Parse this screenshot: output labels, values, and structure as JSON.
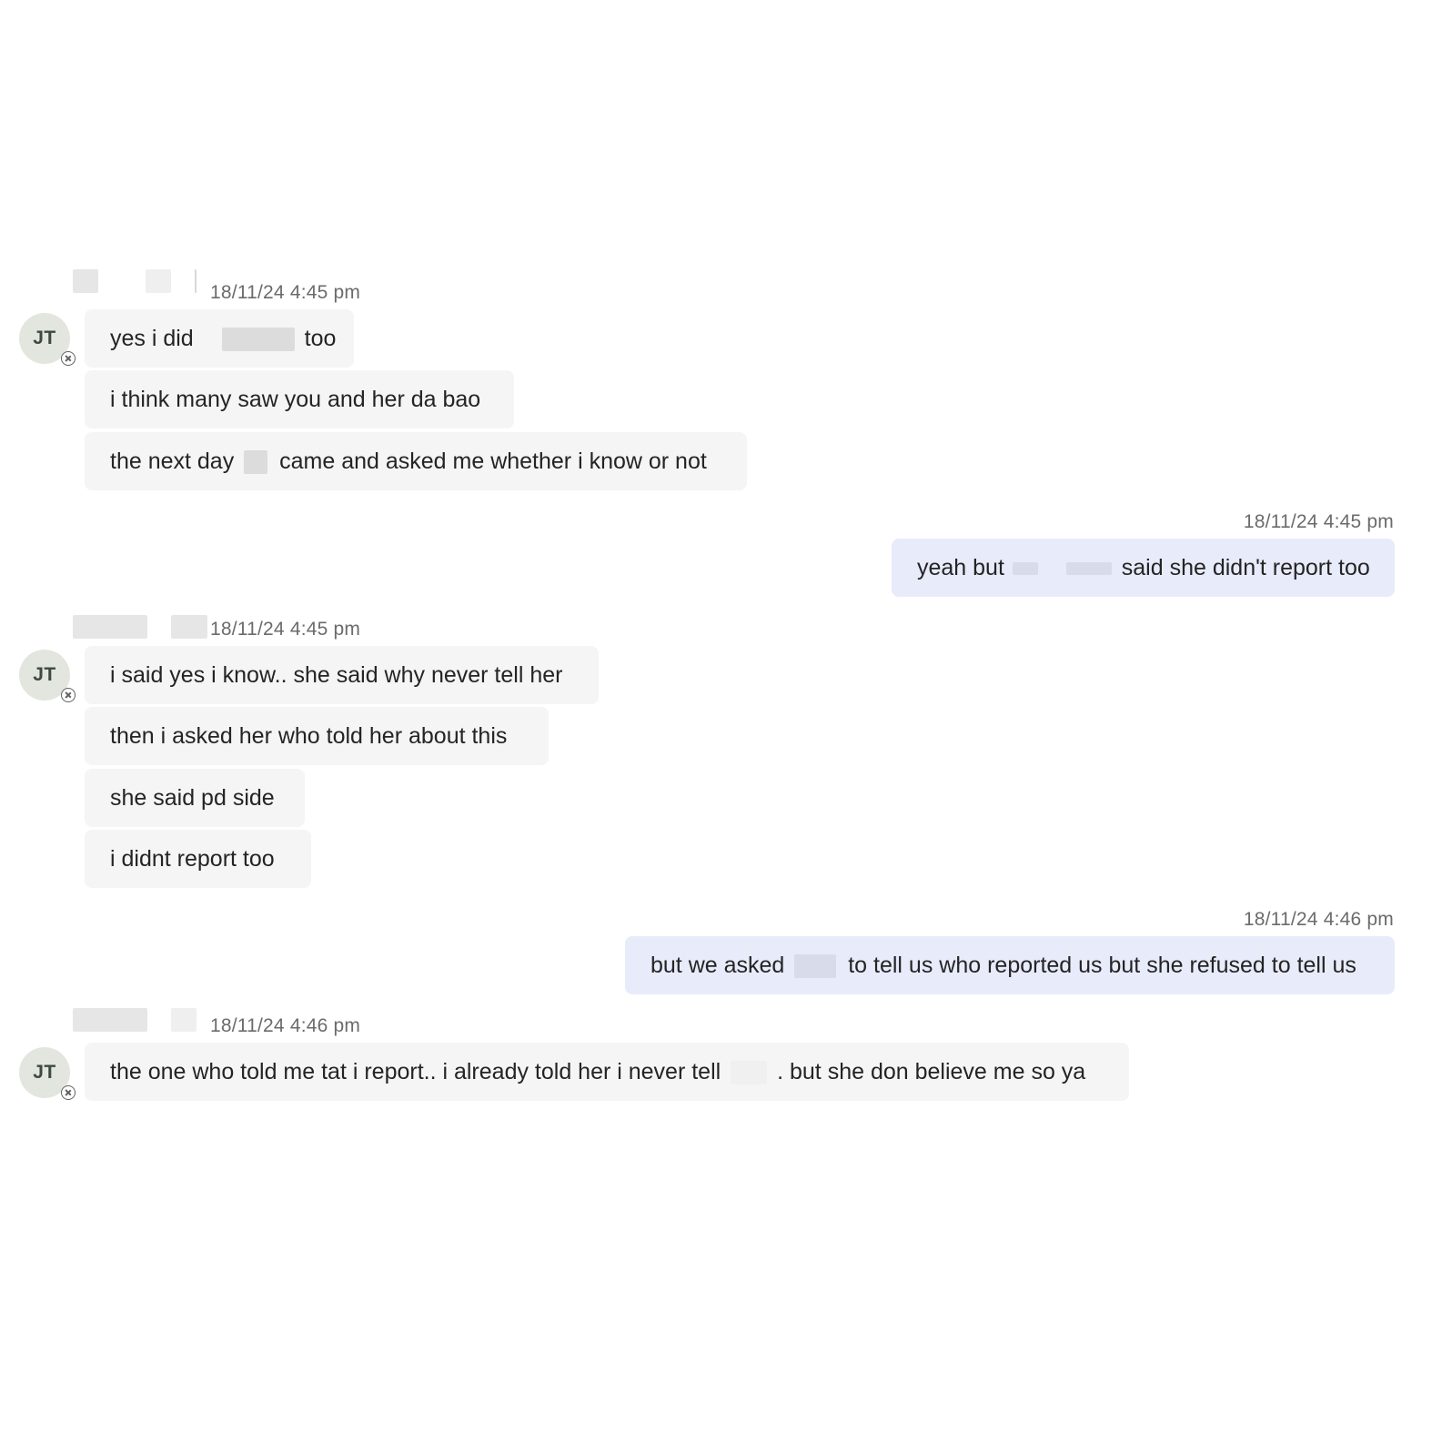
{
  "avatar_initials": "JT",
  "groups": [
    {
      "side": "incoming",
      "timestamp": "18/11/24 4:45 pm",
      "messages": [
        {
          "pre": "yes i did",
          "post": "too"
        },
        {
          "text": "i think many saw you and her da bao"
        },
        {
          "pre": "the next day",
          "post": "came and asked me whether i know or not"
        }
      ]
    },
    {
      "side": "outgoing",
      "timestamp": "18/11/24 4:45 pm",
      "messages": [
        {
          "pre": "yeah but",
          "post": "said she didn't report too"
        }
      ]
    },
    {
      "side": "incoming",
      "timestamp": "18/11/24 4:45 pm",
      "messages": [
        {
          "text": "i said yes i know.. she said why never tell her"
        },
        {
          "text": "then i asked her who told her about this"
        },
        {
          "text": "she said pd side"
        },
        {
          "text": "i didnt report too"
        }
      ]
    },
    {
      "side": "outgoing",
      "timestamp": "18/11/24 4:46 pm",
      "messages": [
        {
          "pre": "but we asked",
          "post": "to tell us who reported us but she refused to tell us"
        }
      ]
    },
    {
      "side": "incoming",
      "timestamp": "18/11/24 4:46 pm",
      "messages": [
        {
          "pre": "the one who told me tat i report.. i already told her i never tell",
          "post": ". but she don believe me so ya"
        }
      ]
    }
  ],
  "colors": {
    "incoming_bubble": "#f5f5f5",
    "outgoing_bubble": "#e8ebfa",
    "avatar_bg": "#e3e6df",
    "timestamp_text": "#6b6b6b"
  }
}
